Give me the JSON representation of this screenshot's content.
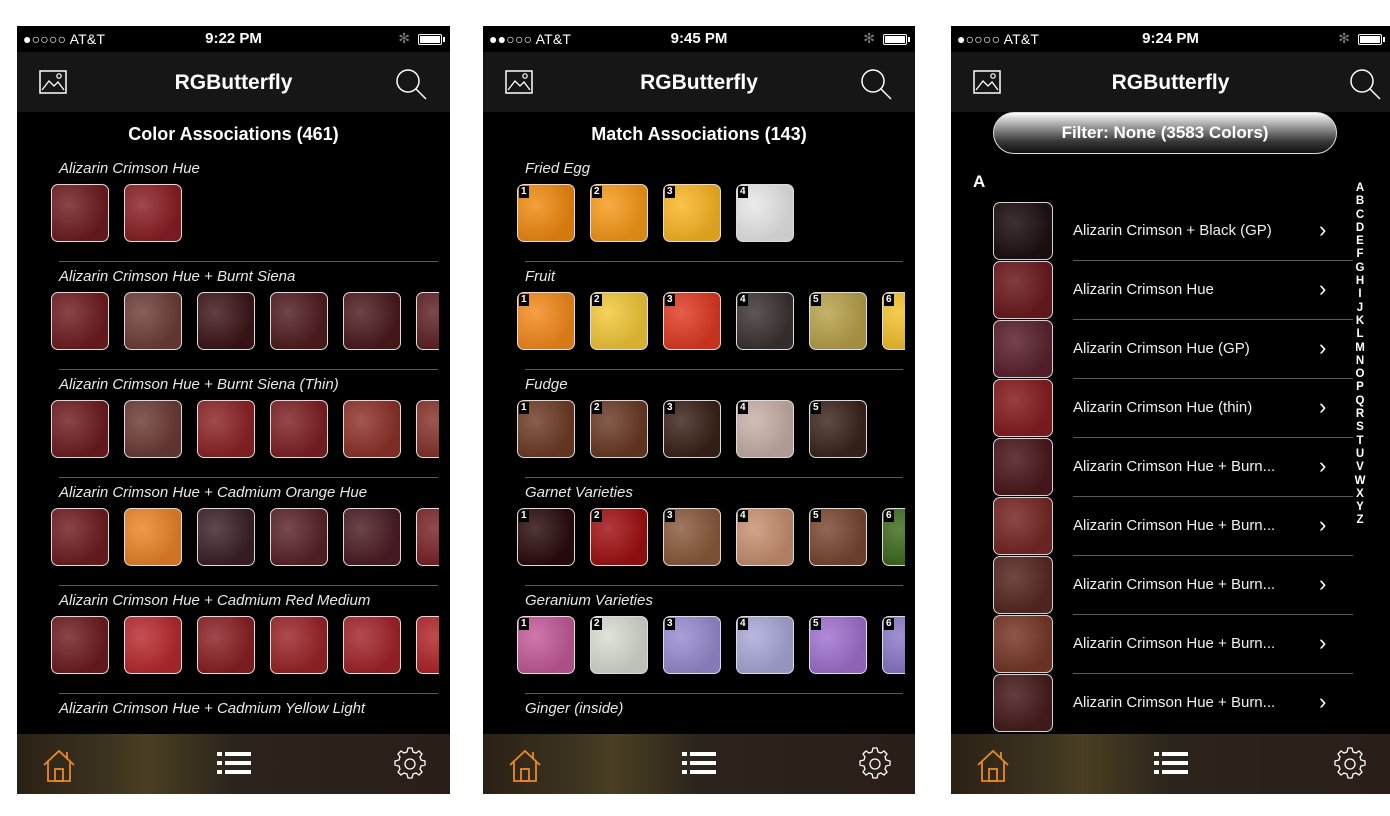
{
  "screens": [
    {
      "status": {
        "carrier": "●○○○○ AT&T",
        "time": "9:22 PM",
        "bluetooth": "✻"
      },
      "nav": {
        "title": "RGButterfly"
      },
      "heading": "Color Associations (461)",
      "sections": [
        {
          "label": "Alizarin Crimson Hue",
          "swatches": [
            {
              "color": "#6e1c20",
              "number": ""
            },
            {
              "color": "#8a1f24",
              "number": ""
            }
          ]
        },
        {
          "label": "Alizarin Crimson Hue + Burnt Siena",
          "swatches": [
            {
              "color": "#6e1c20",
              "number": ""
            },
            {
              "color": "#6e3e38",
              "number": ""
            },
            {
              "color": "#3d1518",
              "number": ""
            },
            {
              "color": "#501c1f",
              "number": ""
            },
            {
              "color": "#4c1a1d",
              "number": ""
            },
            {
              "color": "#5e2024",
              "number": ""
            }
          ]
        },
        {
          "label": "Alizarin Crimson Hue + Burnt Siena (Thin)",
          "swatches": [
            {
              "color": "#6e1c20",
              "number": ""
            },
            {
              "color": "#6c3a36",
              "number": ""
            },
            {
              "color": "#8c2326",
              "number": ""
            },
            {
              "color": "#7e2024",
              "number": ""
            },
            {
              "color": "#8e3228",
              "number": ""
            },
            {
              "color": "#86322a",
              "number": ""
            }
          ]
        },
        {
          "label": "Alizarin Crimson Hue + Cadmium Orange Hue",
          "swatches": [
            {
              "color": "#6e1c20",
              "number": ""
            },
            {
              "color": "#ea8428",
              "number": ""
            },
            {
              "color": "#3c2028",
              "number": ""
            },
            {
              "color": "#5a2228",
              "number": ""
            },
            {
              "color": "#4a1c22",
              "number": ""
            },
            {
              "color": "#7a2228",
              "number": ""
            }
          ]
        },
        {
          "label": "Alizarin Crimson Hue + Cadmium Red Medium",
          "swatches": [
            {
              "color": "#6e1c20",
              "number": ""
            },
            {
              "color": "#b82a2e",
              "number": ""
            },
            {
              "color": "#8a2024",
              "number": ""
            },
            {
              "color": "#9a2428",
              "number": ""
            },
            {
              "color": "#a2242a",
              "number": ""
            },
            {
              "color": "#b02428",
              "number": ""
            }
          ]
        },
        {
          "label": "Alizarin Crimson Hue + Cadmium Yellow Light",
          "swatches": []
        }
      ]
    },
    {
      "status": {
        "carrier": "●●○○○ AT&T",
        "time": "9:45 PM",
        "bluetooth": "✻"
      },
      "nav": {
        "title": "RGButterfly"
      },
      "heading": "Match Associations (143)",
      "sections": [
        {
          "label": "Fried Egg",
          "swatches": [
            {
              "color": "#f08a10",
              "number": "1"
            },
            {
              "color": "#f79a18",
              "number": "2"
            },
            {
              "color": "#fbb624",
              "number": "3"
            },
            {
              "color": "#e8e8e8",
              "number": "4"
            }
          ]
        },
        {
          "label": "Fruit",
          "swatches": [
            {
              "color": "#f48a1c",
              "number": "1"
            },
            {
              "color": "#f2c838",
              "number": "2"
            },
            {
              "color": "#e03a22",
              "number": "3"
            },
            {
              "color": "#3a3230",
              "number": "4"
            },
            {
              "color": "#b8a24a",
              "number": "5"
            },
            {
              "color": "#f3c22c",
              "number": "6"
            }
          ]
        },
        {
          "label": "Fudge",
          "swatches": [
            {
              "color": "#6e3c24",
              "number": "1"
            },
            {
              "color": "#6a3a24",
              "number": "2"
            },
            {
              "color": "#3a2218",
              "number": "3"
            },
            {
              "color": "#c8b0a8",
              "number": "4"
            },
            {
              "color": "#3a241c",
              "number": "5"
            }
          ]
        },
        {
          "label": "Garnet Varieties",
          "swatches": [
            {
              "color": "#2a0a0c",
              "number": "1"
            },
            {
              "color": "#a01012",
              "number": "2"
            },
            {
              "color": "#8a5a3c",
              "number": "3"
            },
            {
              "color": "#c89070",
              "number": "4"
            },
            {
              "color": "#7a4630",
              "number": "5"
            },
            {
              "color": "#3e6a1c",
              "number": "6"
            }
          ]
        },
        {
          "label": "Geranium Varieties",
          "swatches": [
            {
              "color": "#c45a9a",
              "number": "1"
            },
            {
              "color": "#d8dcd0",
              "number": "2"
            },
            {
              "color": "#9a8ad0",
              "number": "3"
            },
            {
              "color": "#a8a8d8",
              "number": "4"
            },
            {
              "color": "#a070d0",
              "number": "5"
            },
            {
              "color": "#8a78c8",
              "number": "6"
            }
          ]
        },
        {
          "label": "Ginger (inside)",
          "swatches": []
        }
      ]
    },
    {
      "status": {
        "carrier": "●○○○○ AT&T",
        "time": "9:24 PM",
        "bluetooth": "✻"
      },
      "nav": {
        "title": "RGButterfly"
      },
      "filter": "Filter: None (3583 Colors)",
      "section_letter": "A",
      "rows": [
        {
          "name": "Alizarin Crimson + Black (GP)",
          "color": "#1e1012"
        },
        {
          "name": "Alizarin Crimson Hue",
          "color": "#6e1c20"
        },
        {
          "name": "Alizarin Crimson Hue (GP)",
          "color": "#5e2430"
        },
        {
          "name": "Alizarin Crimson Hue (thin)",
          "color": "#8a1e22"
        },
        {
          "name": "Alizarin Crimson Hue + Burn...",
          "color": "#4e1a1e"
        },
        {
          "name": "Alizarin Crimson Hue + Burn...",
          "color": "#7a2a26"
        },
        {
          "name": "Alizarin Crimson Hue + Burn...",
          "color": "#5a2a24"
        },
        {
          "name": "Alizarin Crimson Hue + Burn...",
          "color": "#7a3a2a"
        },
        {
          "name": "Alizarin Crimson Hue + Burn...",
          "color": "#4a1e1e"
        }
      ],
      "index": [
        "A",
        "B",
        "C",
        "D",
        "E",
        "F",
        "G",
        "H",
        "I",
        "J",
        "K",
        "L",
        "M",
        "N",
        "O",
        "P",
        "Q",
        "R",
        "S",
        "T",
        "U",
        "V",
        "W",
        "X",
        "Y",
        "Z"
      ]
    }
  ],
  "colors": {
    "accent": "#e8892a",
    "background": "#000000",
    "navbar": "#161616"
  }
}
